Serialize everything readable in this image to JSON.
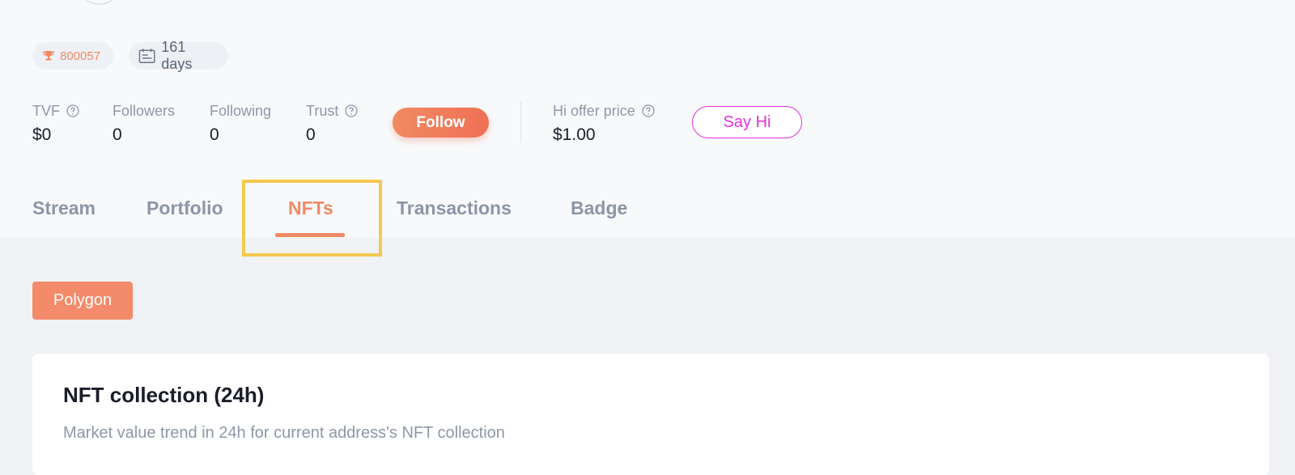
{
  "profile": {
    "rank": "800057",
    "days": "161 days"
  },
  "stats": {
    "tvf": {
      "label": "TVF",
      "value": "$0"
    },
    "followers": {
      "label": "Followers",
      "value": "0"
    },
    "following": {
      "label": "Following",
      "value": "0"
    },
    "trust": {
      "label": "Trust",
      "value": "0"
    },
    "hi_offer": {
      "label": "Hi offer price",
      "value": "$1.00"
    }
  },
  "actions": {
    "follow_label": "Follow",
    "say_hi_label": "Say Hi"
  },
  "tabs": [
    {
      "label": "Stream",
      "active": false
    },
    {
      "label": "Portfolio",
      "active": false
    },
    {
      "label": "NFTs",
      "active": true
    },
    {
      "label": "Transactions",
      "active": false
    },
    {
      "label": "Badge",
      "active": false
    }
  ],
  "chain_filter": {
    "label": "Polygon"
  },
  "nft_card": {
    "title": "NFT collection (24h)",
    "subtitle": "Market value trend in 24h for current address's NFT collection"
  },
  "colors": {
    "accent": "#f08a66",
    "say_hi": "#e032d8",
    "highlight": "#f6c84f"
  },
  "icons": [
    "trophy-icon",
    "calendar-icon",
    "help-icon"
  ]
}
